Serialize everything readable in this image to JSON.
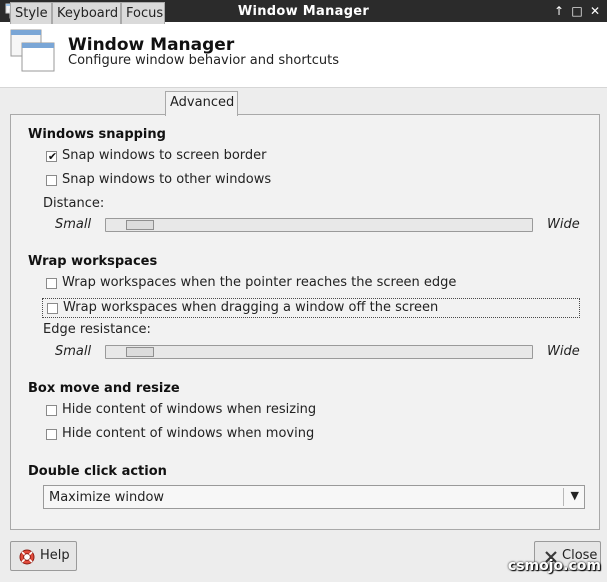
{
  "window": {
    "title": "Window Manager"
  },
  "header": {
    "title": "Window Manager",
    "subtitle": "Configure window behavior and shortcuts",
    "icon": "window-manager-icon"
  },
  "tabs": [
    {
      "label": "Style",
      "mnemonic": "S",
      "active": false
    },
    {
      "label": "Keyboard",
      "mnemonic": "K",
      "active": false
    },
    {
      "label": "Focus",
      "mnemonic": "F",
      "active": false
    },
    {
      "label": "Advanced",
      "mnemonic": "A",
      "active": true
    }
  ],
  "snapping": {
    "title": "Windows snapping",
    "snap_border": {
      "label": "Snap windows to screen border",
      "checked": true
    },
    "snap_windows": {
      "label": "Snap windows to other windows",
      "checked": false
    },
    "distance_label": "Distance:",
    "scale_min": "Small",
    "scale_max": "Wide",
    "distance_level": 0.07
  },
  "wrap": {
    "title": "Wrap workspaces",
    "pointer": {
      "label": "Wrap workspaces when the pointer reaches the screen edge",
      "checked": false
    },
    "dragging": {
      "label": "Wrap workspaces when dragging a window off the screen",
      "checked": false
    },
    "resistance_label": "Edge resistance:",
    "scale_min": "Small",
    "scale_max": "Wide",
    "resistance_level": 0.07
  },
  "box": {
    "title": "Box move and resize",
    "resizing": {
      "label": "Hide content of windows when resizing",
      "checked": false
    },
    "moving": {
      "label": "Hide content of windows when moving",
      "checked": false
    }
  },
  "double_click": {
    "title": "Double click action",
    "selected": "Maximize window"
  },
  "buttons": {
    "help": "Help",
    "close": "Close"
  },
  "watermark": "csmojo.com",
  "colors": {
    "titlebar_bg": "#2b2b2b",
    "header_bg": "#ffffff",
    "panel_bg": "#f2f2f2"
  }
}
